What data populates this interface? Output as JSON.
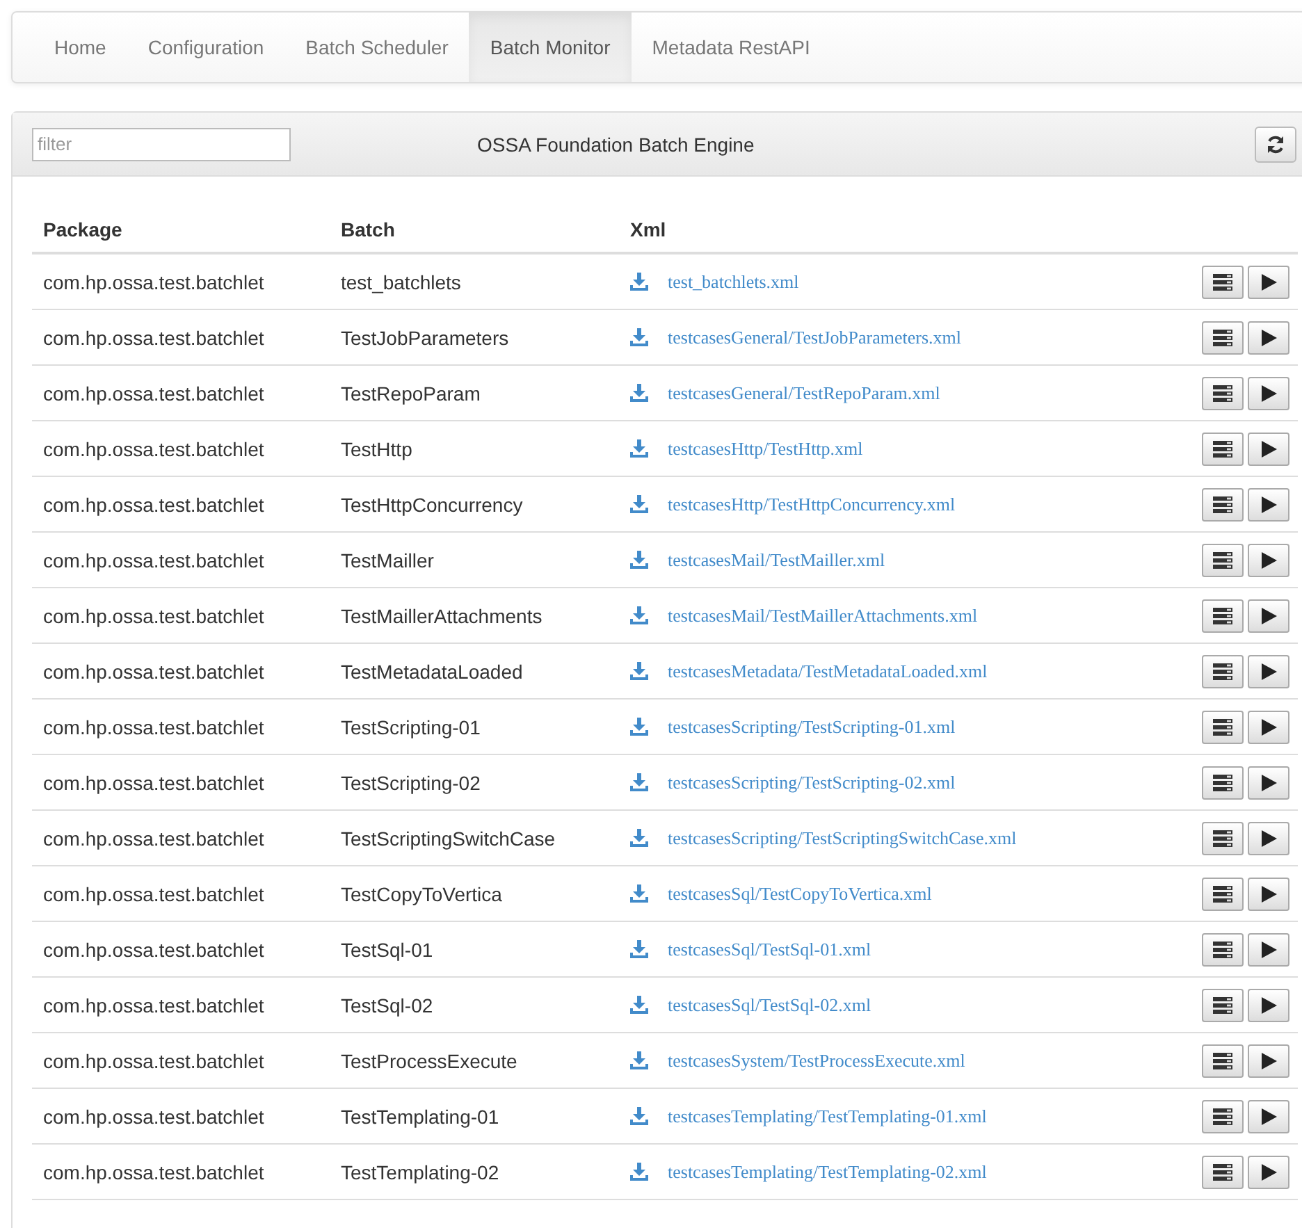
{
  "nav": {
    "tabs": [
      {
        "label": "Home",
        "selected": false
      },
      {
        "label": "Configuration",
        "selected": false
      },
      {
        "label": "Batch Scheduler",
        "selected": false
      },
      {
        "label": "Batch Monitor",
        "selected": true
      },
      {
        "label": "Metadata RestAPI",
        "selected": false
      }
    ]
  },
  "panel": {
    "filter": {
      "placeholder": "filter"
    },
    "title": "OSSA Foundation Batch Engine"
  },
  "table": {
    "columns": [
      "Package",
      "Batch",
      "Xml"
    ],
    "rows": [
      {
        "package": "com.hp.ossa.test.batchlet",
        "batch": "test_batchlets",
        "xml": "test_batchlets.xml"
      },
      {
        "package": "com.hp.ossa.test.batchlet",
        "batch": "TestJobParameters",
        "xml": "testcasesGeneral/TestJobParameters.xml"
      },
      {
        "package": "com.hp.ossa.test.batchlet",
        "batch": "TestRepoParam",
        "xml": "testcasesGeneral/TestRepoParam.xml"
      },
      {
        "package": "com.hp.ossa.test.batchlet",
        "batch": "TestHttp",
        "xml": "testcasesHttp/TestHttp.xml"
      },
      {
        "package": "com.hp.ossa.test.batchlet",
        "batch": "TestHttpConcurrency",
        "xml": "testcasesHttp/TestHttpConcurrency.xml"
      },
      {
        "package": "com.hp.ossa.test.batchlet",
        "batch": "TestMailler",
        "xml": "testcasesMail/TestMailler.xml"
      },
      {
        "package": "com.hp.ossa.test.batchlet",
        "batch": "TestMaillerAttachments",
        "xml": "testcasesMail/TestMaillerAttachments.xml"
      },
      {
        "package": "com.hp.ossa.test.batchlet",
        "batch": "TestMetadataLoaded",
        "xml": "testcasesMetadata/TestMetadataLoaded.xml"
      },
      {
        "package": "com.hp.ossa.test.batchlet",
        "batch": "TestScripting-01",
        "xml": "testcasesScripting/TestScripting-01.xml"
      },
      {
        "package": "com.hp.ossa.test.batchlet",
        "batch": "TestScripting-02",
        "xml": "testcasesScripting/TestScripting-02.xml"
      },
      {
        "package": "com.hp.ossa.test.batchlet",
        "batch": "TestScriptingSwitchCase",
        "xml": "testcasesScripting/TestScriptingSwitchCase.xml"
      },
      {
        "package": "com.hp.ossa.test.batchlet",
        "batch": "TestCopyToVertica",
        "xml": "testcasesSql/TestCopyToVertica.xml"
      },
      {
        "package": "com.hp.ossa.test.batchlet",
        "batch": "TestSql-01",
        "xml": "testcasesSql/TestSql-01.xml"
      },
      {
        "package": "com.hp.ossa.test.batchlet",
        "batch": "TestSql-02",
        "xml": "testcasesSql/TestSql-02.xml"
      },
      {
        "package": "com.hp.ossa.test.batchlet",
        "batch": "TestProcessExecute",
        "xml": "testcasesSystem/TestProcessExecute.xml"
      },
      {
        "package": "com.hp.ossa.test.batchlet",
        "batch": "TestTemplating-01",
        "xml": "testcasesTemplating/TestTemplating-01.xml"
      },
      {
        "package": "com.hp.ossa.test.batchlet",
        "batch": "TestTemplating-02",
        "xml": "testcasesTemplating/TestTemplating-02.xml"
      }
    ]
  }
}
